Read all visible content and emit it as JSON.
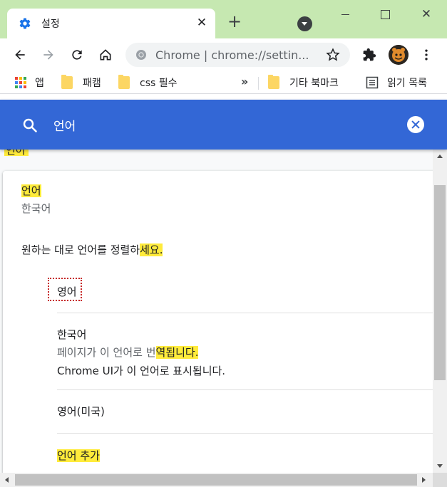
{
  "window": {
    "tab_title": "설정",
    "tab_close_glyph": "✕",
    "new_tab_glyph": "+",
    "close_glyph": "✕",
    "frame_color": "#c6e8b1"
  },
  "omnibox": {
    "scheme_label": "Chrome",
    "separator": "|",
    "url": "chrome://settin..."
  },
  "bookmarks": {
    "apps": "앱",
    "items": [
      "패캠",
      "css 필수"
    ],
    "overflow": "»",
    "other": "기타 북마크",
    "reading_list": "읽기 목록"
  },
  "search": {
    "query": "언어",
    "header_color": "#3367d6"
  },
  "section_stub": "언어",
  "languages_card": {
    "title": "언어",
    "current_language": "한국어",
    "description_prefix": "원하는 대로 언어를 정렬하",
    "description_highlight": "세요.",
    "highlight_color": "#ffeb3b",
    "rows": [
      {
        "name": "영어"
      },
      {
        "name": "한국어",
        "translate_prefix": "페이지가 이 언어로 번",
        "translate_highlight": "역됩니다.",
        "ui_note": "Chrome UI가 이 언어로 표시됩니다."
      },
      {
        "name": "영어(미국)"
      }
    ],
    "add_language": "언어 추가"
  },
  "icons": {
    "tab": "gear-icon",
    "back": "back-arrow-icon",
    "forward": "forward-arrow-icon",
    "reload": "reload-icon",
    "home": "home-icon",
    "site": "chrome-logo-icon",
    "star": "star-icon",
    "extensions": "puzzle-icon",
    "menu": "kebab-menu-icon",
    "search": "search-icon",
    "clear": "clear-icon"
  }
}
